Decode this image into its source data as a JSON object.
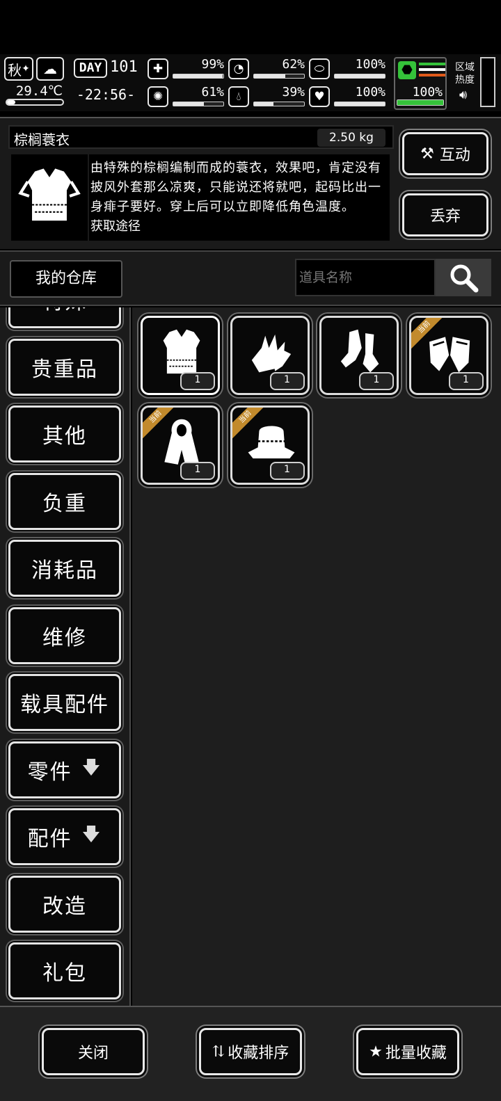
{
  "hud": {
    "season": "秋",
    "temperature": "29.4℃",
    "day_label": "DAY",
    "day_number": "101",
    "time": "-22:56-",
    "stats": [
      {
        "icon": "first-aid-icon",
        "value": "99%",
        "fill": 0.99
      },
      {
        "icon": "stomach-icon",
        "value": "62%",
        "fill": 0.62
      },
      {
        "icon": "pill-icon",
        "value": "100%",
        "fill": 1.0
      },
      {
        "icon": "brain-icon",
        "value": "61%",
        "fill": 0.61
      },
      {
        "icon": "water-drop-icon",
        "value": "39%",
        "fill": 0.39
      },
      {
        "icon": "heart-icon",
        "value": "100%",
        "fill": 1.0
      }
    ],
    "stamina": "100%",
    "region_heat_label": "区域热度"
  },
  "detail": {
    "item_name": "棕榈蓑衣",
    "weight": "2.50 kg",
    "description": "由特殊的棕榈编制而成的蓑衣，效果吧，肯定没有披风外套那么凉爽，只能说还将就吧，起码比出一身痱子要好。穿上后可以立即降低角色温度。",
    "description_cutoff": "获取途径",
    "interact_label": "互动",
    "discard_label": "丢弃"
  },
  "toolbar": {
    "warehouse_label": "我的仓库",
    "search_placeholder": "道具名称"
  },
  "categories": [
    {
      "label": "特殊",
      "arrow": ""
    },
    {
      "label": "贵重品",
      "arrow": ""
    },
    {
      "label": "其他",
      "arrow": ""
    },
    {
      "label": "负重",
      "arrow": ""
    },
    {
      "label": "消耗品",
      "arrow": ""
    },
    {
      "label": "维修",
      "arrow": ""
    },
    {
      "label": "载具配件",
      "arrow": ""
    },
    {
      "label": "零件",
      "arrow": "🡇"
    },
    {
      "label": "配件",
      "arrow": "🡇"
    },
    {
      "label": "改造",
      "arrow": ""
    },
    {
      "label": "礼包",
      "arrow": ""
    }
  ],
  "items": [
    {
      "icon": "palm-raincoat-icon",
      "qty": "1",
      "equipped": false,
      "selected": true
    },
    {
      "icon": "gloves-icon",
      "qty": "1",
      "equipped": false,
      "selected": false
    },
    {
      "icon": "socks-icon",
      "qty": "1",
      "equipped": false,
      "selected": false
    },
    {
      "icon": "fingerless-gloves-icon",
      "qty": "1",
      "equipped": true,
      "selected": false
    },
    {
      "icon": "hooded-cloak-icon",
      "qty": "1",
      "equipped": true,
      "selected": false
    },
    {
      "icon": "straw-hat-icon",
      "qty": "1",
      "equipped": true,
      "selected": false
    }
  ],
  "equipped_badge": "当前",
  "footer": {
    "close_label": "关闭",
    "sort_label": "收藏排序",
    "batch_fav_label": "批量收藏"
  }
}
